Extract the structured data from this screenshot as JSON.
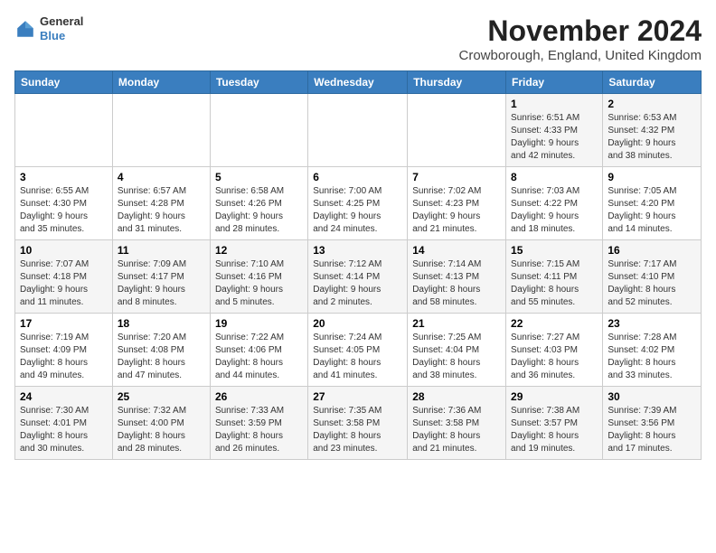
{
  "logo": {
    "general": "General",
    "blue": "Blue"
  },
  "header": {
    "month": "November 2024",
    "location": "Crowborough, England, United Kingdom"
  },
  "weekdays": [
    "Sunday",
    "Monday",
    "Tuesday",
    "Wednesday",
    "Thursday",
    "Friday",
    "Saturday"
  ],
  "weeks": [
    [
      {
        "day": "",
        "info": ""
      },
      {
        "day": "",
        "info": ""
      },
      {
        "day": "",
        "info": ""
      },
      {
        "day": "",
        "info": ""
      },
      {
        "day": "",
        "info": ""
      },
      {
        "day": "1",
        "info": "Sunrise: 6:51 AM\nSunset: 4:33 PM\nDaylight: 9 hours\nand 42 minutes."
      },
      {
        "day": "2",
        "info": "Sunrise: 6:53 AM\nSunset: 4:32 PM\nDaylight: 9 hours\nand 38 minutes."
      }
    ],
    [
      {
        "day": "3",
        "info": "Sunrise: 6:55 AM\nSunset: 4:30 PM\nDaylight: 9 hours\nand 35 minutes."
      },
      {
        "day": "4",
        "info": "Sunrise: 6:57 AM\nSunset: 4:28 PM\nDaylight: 9 hours\nand 31 minutes."
      },
      {
        "day": "5",
        "info": "Sunrise: 6:58 AM\nSunset: 4:26 PM\nDaylight: 9 hours\nand 28 minutes."
      },
      {
        "day": "6",
        "info": "Sunrise: 7:00 AM\nSunset: 4:25 PM\nDaylight: 9 hours\nand 24 minutes."
      },
      {
        "day": "7",
        "info": "Sunrise: 7:02 AM\nSunset: 4:23 PM\nDaylight: 9 hours\nand 21 minutes."
      },
      {
        "day": "8",
        "info": "Sunrise: 7:03 AM\nSunset: 4:22 PM\nDaylight: 9 hours\nand 18 minutes."
      },
      {
        "day": "9",
        "info": "Sunrise: 7:05 AM\nSunset: 4:20 PM\nDaylight: 9 hours\nand 14 minutes."
      }
    ],
    [
      {
        "day": "10",
        "info": "Sunrise: 7:07 AM\nSunset: 4:18 PM\nDaylight: 9 hours\nand 11 minutes."
      },
      {
        "day": "11",
        "info": "Sunrise: 7:09 AM\nSunset: 4:17 PM\nDaylight: 9 hours\nand 8 minutes."
      },
      {
        "day": "12",
        "info": "Sunrise: 7:10 AM\nSunset: 4:16 PM\nDaylight: 9 hours\nand 5 minutes."
      },
      {
        "day": "13",
        "info": "Sunrise: 7:12 AM\nSunset: 4:14 PM\nDaylight: 9 hours\nand 2 minutes."
      },
      {
        "day": "14",
        "info": "Sunrise: 7:14 AM\nSunset: 4:13 PM\nDaylight: 8 hours\nand 58 minutes."
      },
      {
        "day": "15",
        "info": "Sunrise: 7:15 AM\nSunset: 4:11 PM\nDaylight: 8 hours\nand 55 minutes."
      },
      {
        "day": "16",
        "info": "Sunrise: 7:17 AM\nSunset: 4:10 PM\nDaylight: 8 hours\nand 52 minutes."
      }
    ],
    [
      {
        "day": "17",
        "info": "Sunrise: 7:19 AM\nSunset: 4:09 PM\nDaylight: 8 hours\nand 49 minutes."
      },
      {
        "day": "18",
        "info": "Sunrise: 7:20 AM\nSunset: 4:08 PM\nDaylight: 8 hours\nand 47 minutes."
      },
      {
        "day": "19",
        "info": "Sunrise: 7:22 AM\nSunset: 4:06 PM\nDaylight: 8 hours\nand 44 minutes."
      },
      {
        "day": "20",
        "info": "Sunrise: 7:24 AM\nSunset: 4:05 PM\nDaylight: 8 hours\nand 41 minutes."
      },
      {
        "day": "21",
        "info": "Sunrise: 7:25 AM\nSunset: 4:04 PM\nDaylight: 8 hours\nand 38 minutes."
      },
      {
        "day": "22",
        "info": "Sunrise: 7:27 AM\nSunset: 4:03 PM\nDaylight: 8 hours\nand 36 minutes."
      },
      {
        "day": "23",
        "info": "Sunrise: 7:28 AM\nSunset: 4:02 PM\nDaylight: 8 hours\nand 33 minutes."
      }
    ],
    [
      {
        "day": "24",
        "info": "Sunrise: 7:30 AM\nSunset: 4:01 PM\nDaylight: 8 hours\nand 30 minutes."
      },
      {
        "day": "25",
        "info": "Sunrise: 7:32 AM\nSunset: 4:00 PM\nDaylight: 8 hours\nand 28 minutes."
      },
      {
        "day": "26",
        "info": "Sunrise: 7:33 AM\nSunset: 3:59 PM\nDaylight: 8 hours\nand 26 minutes."
      },
      {
        "day": "27",
        "info": "Sunrise: 7:35 AM\nSunset: 3:58 PM\nDaylight: 8 hours\nand 23 minutes."
      },
      {
        "day": "28",
        "info": "Sunrise: 7:36 AM\nSunset: 3:58 PM\nDaylight: 8 hours\nand 21 minutes."
      },
      {
        "day": "29",
        "info": "Sunrise: 7:38 AM\nSunset: 3:57 PM\nDaylight: 8 hours\nand 19 minutes."
      },
      {
        "day": "30",
        "info": "Sunrise: 7:39 AM\nSunset: 3:56 PM\nDaylight: 8 hours\nand 17 minutes."
      }
    ]
  ]
}
